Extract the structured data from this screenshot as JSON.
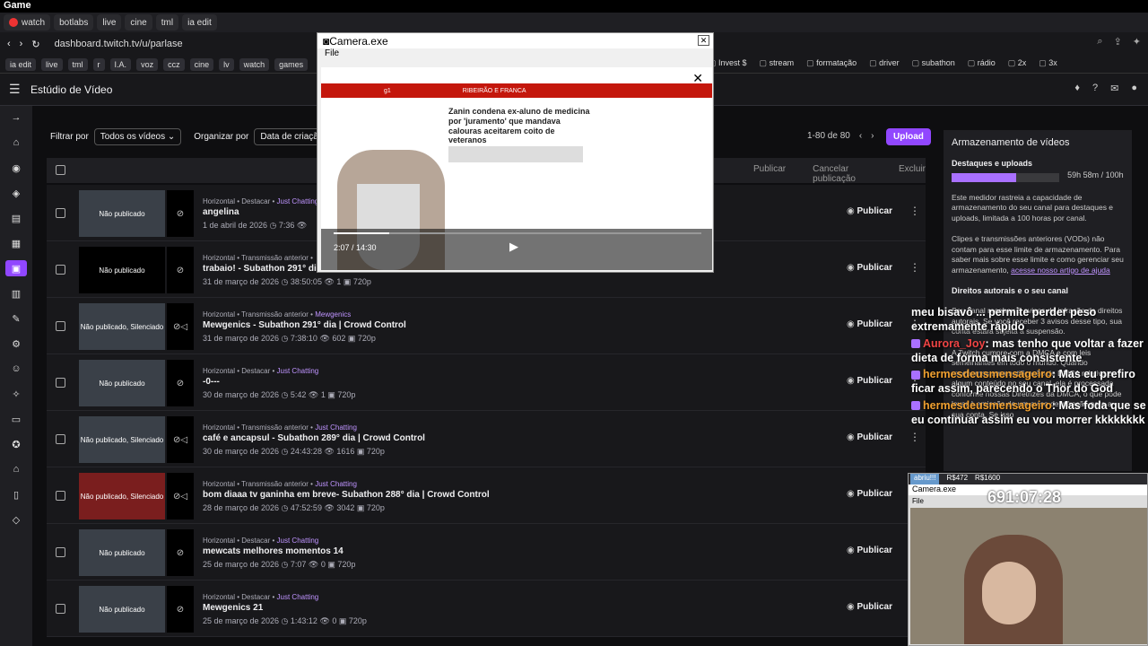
{
  "os_title": "Game",
  "tabs": [
    "watch",
    "botlabs",
    "live",
    "cine",
    "tml",
    "ia edit"
  ],
  "address": {
    "url": "dashboard.twitch.tv/u/parlase"
  },
  "bookmarks": [
    "ia edit",
    "live",
    "tml",
    "r",
    "I.A.",
    "voz",
    "ccz",
    "cine",
    "lv",
    "watch",
    "games"
  ],
  "bookmarks_right": [
    "Invest $",
    "stream",
    "formatação",
    "driver",
    "subathon",
    "rádio",
    "2x",
    "3x"
  ],
  "header": {
    "title": "Estúdio de Vídeo"
  },
  "filters": {
    "filter_label": "Filtrar por",
    "filter_value": "Todos os vídeos",
    "sort_label": "Organizar por",
    "sort_value": "Data de criação"
  },
  "pager": {
    "range": "1-80 de 80"
  },
  "upload_label": "Upload",
  "bulk": {
    "publish": "Publicar",
    "cancel": "Cancelar publicação",
    "delete": "Excluir"
  },
  "rows": [
    {
      "meta": "Horizontal • Destacar •",
      "cat": "Just Chatting",
      "title": "angelina",
      "stats": "1 de abril de 2026  ◷ 7:36  👁",
      "thumb": "Não publicado"
    },
    {
      "meta": "Horizontal • Transmissão anterior •",
      "cat": "",
      "title": "trabaio! - Subathon 291° dia | C",
      "stats": "31 de março de 2026  ◷ 38:50:05  👁 1  ▣ 720p",
      "thumb": "Não publicado"
    },
    {
      "meta": "Horizontal • Transmissão anterior •",
      "cat": "Mewgenics",
      "title": "Mewgenics - Subathon 291° dia | Crowd Control",
      "stats": "31 de março de 2026  ◷ 7:38:10  👁 602  ▣ 720p",
      "thumb": "Não publicado, Silenciado"
    },
    {
      "meta": "Horizontal • Destacar •",
      "cat": "Just Chatting",
      "title": "-0---",
      "stats": "30 de março de 2026  ◷ 5:42  👁 1  ▣ 720p",
      "thumb": "Não publicado"
    },
    {
      "meta": "Horizontal • Transmissão anterior •",
      "cat": "Just Chatting",
      "title": "café e ancapsul - Subathon 289° dia | Crowd Control",
      "stats": "30 de março de 2026  ◷ 24:43:28  👁 1616  ▣ 720p",
      "thumb": "Não publicado, Silenciado"
    },
    {
      "meta": "Horizontal • Transmissão anterior •",
      "cat": "Just Chatting",
      "title": "bom diaaa tv ganinha em breve- Subathon 288° dia | Crowd Control",
      "stats": "28 de março de 2026  ◷ 47:52:59  👁 3042  ▣ 720p",
      "thumb": "Não publicado, Silenciado"
    },
    {
      "meta": "Horizontal • Destacar •",
      "cat": "Just Chatting",
      "title": "mewcats melhores momentos 14",
      "stats": "25 de março de 2026  ◷ 7:07  👁 0  ▣ 720p",
      "thumb": "Não publicado"
    },
    {
      "meta": "Horizontal • Destacar •",
      "cat": "Just Chatting",
      "title": "Mewgenics 21",
      "stats": "25 de março de 2026  ◷ 1:43:12  👁 0  ▣ 720p",
      "thumb": "Não publicado"
    }
  ],
  "publish_label": "Publicar",
  "storage": {
    "title": "Armazenamento de vídeos",
    "sub": "Destaques e uploads",
    "usage": "59h 58m / 100h",
    "fill": 0.6,
    "p1": "Este medidor rastreia a capacidade de armazenamento do seu canal para destaques e uploads, limitada a 100 horas por canal.",
    "p2": "Clipes e transmissões anteriores (VODs) não contam para esse limite de armazenamento. Para saber mais sobre esse limite e como gerenciar seu armazenamento,",
    "link": "acesse nosso artigo de ajuda",
    "h3": "Direitos autorais e o seu canal",
    "p3": "Seu canal recebeu 0 avisos de infração de direitos autorais. Se você receber 3 avisos desse tipo, sua conta estará sujeita a suspensão.",
    "p4": "A Twitch cumpre com a DMCA e com leis semelhantes em todo o mundo. Quando recebemos uma notificação de DMCA relativa a algum conteúdo no seu canal, ela é processada conforme nossas Diretrizes da DMCA, o que pode levar à emissão de um aviso de infração para a sua conta. Se isso"
  },
  "chat": [
    {
      "user": "",
      "text": "meu bisavô ... permite perder peso extremamente rápido"
    },
    {
      "user": "Aurora_Joy",
      "text": ": mas tenho que voltar a fazer dieta de forma mais consistente"
    },
    {
      "user": "hermesdeusmensageiro",
      "text": ": Mas eu prefiro ficar assim, parecendo o Thor do God"
    },
    {
      "user": "hermesdeusmensageiro",
      "text": ": Mas foda que se eu continuar assim eu vou morrer kkkkkkkk"
    }
  ],
  "camera": {
    "title": "Camera.exe",
    "menu": "File",
    "headline": "Zanin condena ex-aluno de medicina por 'juramento' que mandava calouras aceitarem coito de veteranos",
    "section": "RIBEIRÃO E FRANCA",
    "brand": "g1",
    "time": "2:07 / 14:30",
    "progress": 0.15
  },
  "obs": {
    "label": "abriu!!!",
    "v1": "R$472",
    "v2": "R$1600",
    "title": "Camera.exe",
    "file": "File",
    "timer": "691:07:28"
  }
}
